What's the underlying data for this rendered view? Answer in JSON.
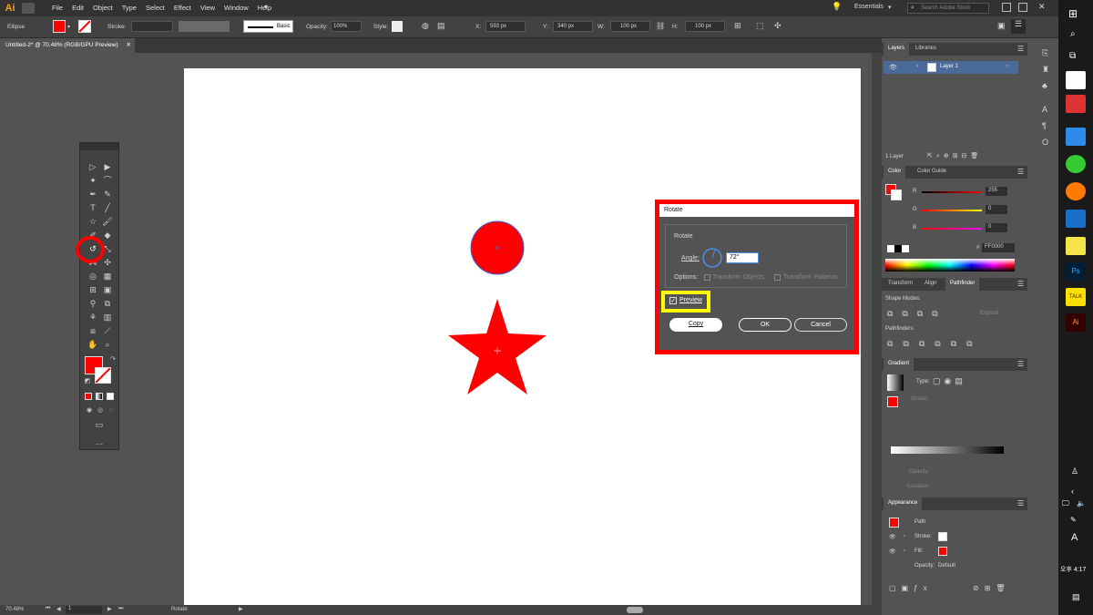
{
  "app": {
    "logo": "Ai"
  },
  "menu": [
    "File",
    "Edit",
    "Object",
    "Type",
    "Select",
    "Effect",
    "View",
    "Window",
    "Help"
  ],
  "workspace": "Essentials",
  "search_placeholder": "Search Adobe Stock",
  "control_bar": {
    "selection": "Ellipse",
    "stroke_label": "Stroke:",
    "brush": "Basic",
    "opacity_label": "Opacity:",
    "opacity_value": "100%",
    "style_label": "Style:",
    "x_label": "X:",
    "x_value": "593 px",
    "y_label": "Y:",
    "y_value": "340 px",
    "w_label": "W:",
    "w_value": "100 px",
    "h_label": "H:",
    "h_value": "100 px"
  },
  "document_tab": "Untitled-2* @ 70.48% (RGB/GPU Preview)",
  "status": {
    "zoom": "70.48%",
    "page": "1",
    "tool": "Rotate"
  },
  "layers_panel": {
    "tabs": [
      "Layers",
      "Libraries"
    ],
    "layer_name": "Layer 1",
    "footer": "1 Layer"
  },
  "color_panel": {
    "tabs": [
      "Color",
      "Color Guide"
    ],
    "r_label": "R",
    "r": "255",
    "g_label": "G",
    "g": "0",
    "b_label": "B",
    "b": "0",
    "hex_label": "#",
    "hex": "FF0000"
  },
  "pathfinder_panel": {
    "tabs": [
      "Transform",
      "Align",
      "Pathfinder"
    ],
    "shape_modes": "Shape Modes:",
    "expand": "Expand",
    "pathfinders": "Pathfinders:"
  },
  "gradient_panel": {
    "title": "Gradient",
    "type_label": "Type:",
    "stroke_label": "Stroke:",
    "opacity_label": "Opacity:",
    "location_label": "Location:"
  },
  "appearance_panel": {
    "title": "Appearance",
    "path": "Path",
    "stroke": "Stroke:",
    "fill": "Fill:",
    "opacity": "Opacity:",
    "opacity_value": "Default"
  },
  "rotate_dialog": {
    "title": "Rotate",
    "section": "Rotate",
    "angle_label": "Angle:",
    "angle_value": "72°",
    "options_label": "Options:",
    "transform_objects": "Transform Objects",
    "transform_patterns": "Transform Patterns",
    "preview": "Preview",
    "copy": "Copy",
    "ok": "OK",
    "cancel": "Cancel"
  },
  "taskbar": {
    "ime": "A",
    "time": "오후 4:17"
  },
  "colors": {
    "fill": "#ff0000",
    "highlight_red": "#ff0000",
    "highlight_yellow": "#ffff00",
    "accent": "#4a90e2"
  }
}
